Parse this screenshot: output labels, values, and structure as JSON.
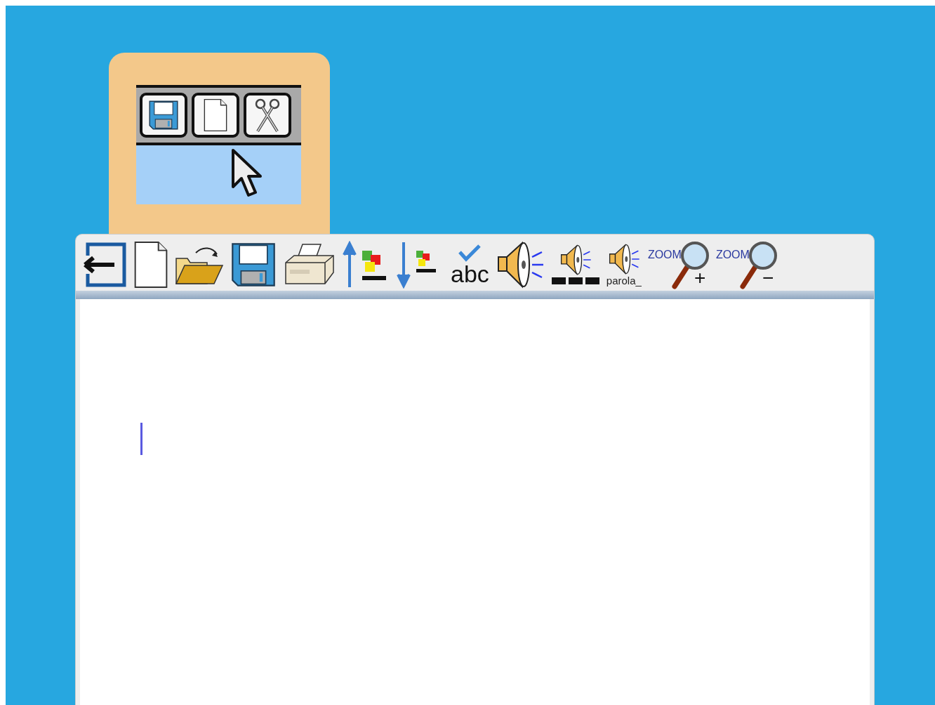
{
  "preview": {
    "tiles": [
      {
        "kind": "save"
      },
      {
        "kind": "new"
      },
      {
        "kind": "cut"
      }
    ]
  },
  "toolbar": [
    {
      "kind": "back"
    },
    {
      "kind": "new"
    },
    {
      "kind": "open"
    },
    {
      "kind": "save"
    },
    {
      "kind": "print"
    },
    {
      "kind": "move_up"
    },
    {
      "kind": "move_down"
    },
    {
      "kind": "spellcheck",
      "label": "abc"
    },
    {
      "kind": "speak"
    },
    {
      "kind": "speak_sentence"
    },
    {
      "kind": "speak_word",
      "label": "parola_"
    },
    {
      "kind": "zoom",
      "label": "ZOOM",
      "sign": "+"
    },
    {
      "kind": "zoom",
      "label": "ZOOM",
      "sign": "−"
    }
  ]
}
